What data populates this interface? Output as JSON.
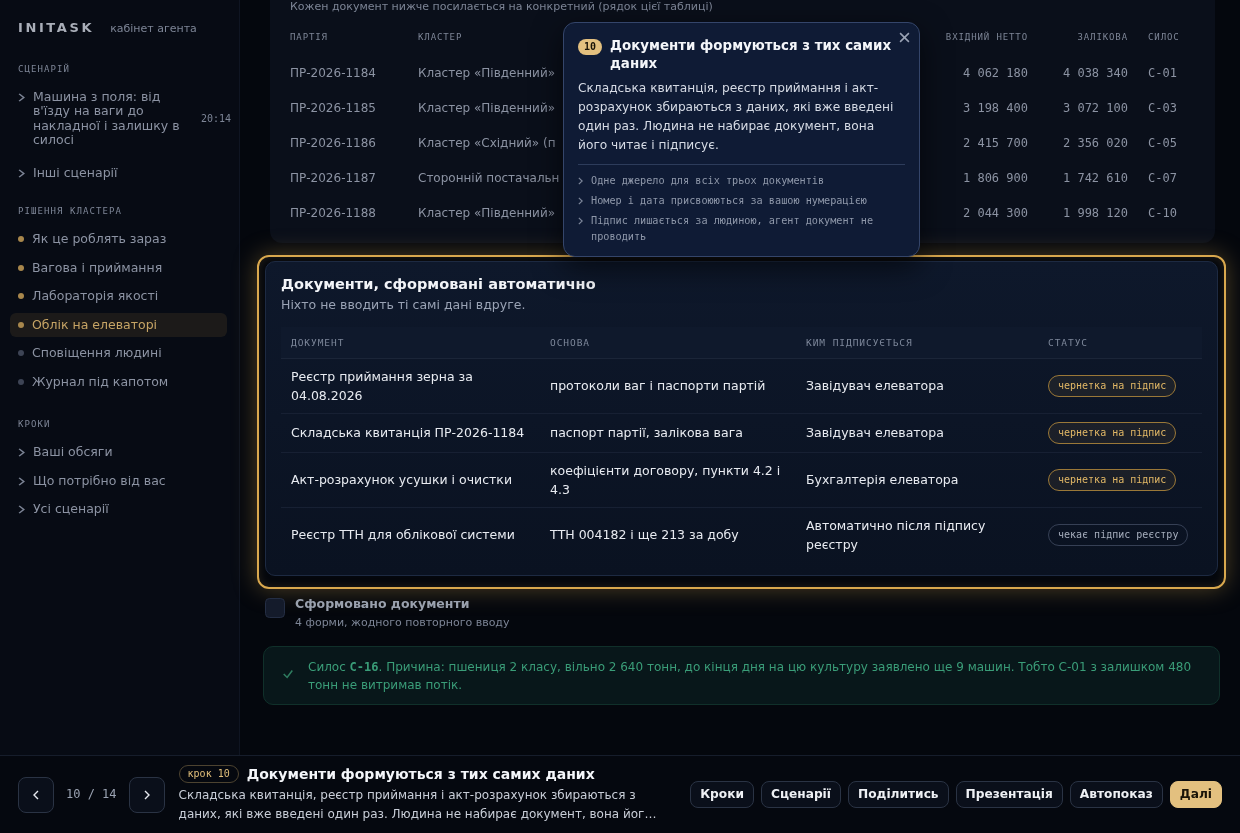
{
  "sidebar": {
    "brand": "INITASK",
    "subtitle": "кабінет агента",
    "sections": [
      {
        "title": "СЦЕНАРІЙ",
        "items": [
          {
            "kind": "link",
            "label": "Машина з поля: від в'їзду на ваги до накладної і залишку в силосі",
            "meta": "20:14"
          },
          {
            "kind": "link",
            "label": "Інші сценарії"
          }
        ]
      },
      {
        "title": "РІШЕННЯ КЛАСТЕРА",
        "items": [
          {
            "kind": "step",
            "label": "Як це роблять зараз",
            "done": true,
            "selected": false
          },
          {
            "kind": "step",
            "label": "Вагова і приймання",
            "done": true,
            "selected": false
          },
          {
            "kind": "step",
            "label": "Лабораторія якості",
            "done": true,
            "selected": false
          },
          {
            "kind": "step",
            "label": "Облік на елеваторі",
            "done": true,
            "selected": true
          },
          {
            "kind": "step",
            "label": "Сповіщення людині",
            "done": false,
            "selected": false
          },
          {
            "kind": "step",
            "label": "Журнал під капотом",
            "done": false,
            "selected": false
          }
        ]
      },
      {
        "title": "КРОКИ",
        "items": [
          {
            "kind": "link",
            "label": "Ваші обсяги"
          },
          {
            "kind": "link",
            "label": "Що потрібно від вас"
          },
          {
            "kind": "link",
            "label": "Усі сценарії"
          }
        ]
      }
    ]
  },
  "batches_table": {
    "caption": "Кожен документ нижче посилається на конкретний (рядок цієї таблиці)",
    "columns": [
      "ПАРТІЯ",
      "КЛАСТЕР",
      "ВХІДНИЙ НЕТТО",
      "ЗАЛІКОВА",
      "СИЛОС"
    ],
    "rows": [
      [
        "ПР-2026-1184",
        "Кластер «Південний»",
        "4 062 180",
        "4 038 340",
        "С-01"
      ],
      [
        "ПР-2026-1185",
        "Кластер «Південний»",
        "3 198 400",
        "3 072 100",
        "С-03"
      ],
      [
        "ПР-2026-1186",
        "Кластер «Східний» (п",
        "2 415 700",
        "2 356 020",
        "С-05"
      ],
      [
        "ПР-2026-1187",
        "Сторонній постачальн",
        "1 806 900",
        "1 742 610",
        "С-07"
      ],
      [
        "ПР-2026-1188",
        "Кластер «Південний»",
        "2 044 300",
        "1 998 120",
        "С-10"
      ]
    ]
  },
  "documents_card": {
    "title": "Документи, сформовані автоматично",
    "subtitle": "Ніхто не вводить ті самі дані вдруге.",
    "columns": [
      "ДОКУМЕНТ",
      "ОСНОВА",
      "КИМ ПІДПИСУЄТЬСЯ",
      "СТАТУС"
    ],
    "rows": [
      {
        "document": "Реєстр приймання зерна за 04.08.2026",
        "basis": "протоколи ваг і паспорти партій",
        "signer": "Завідувач елеватора",
        "status": {
          "kind": "draft",
          "label": "чернетка на підпис"
        }
      },
      {
        "document": "Складська квитанція ПР-2026-1184",
        "basis": "паспорт партії, залікова вага",
        "signer": "Завідувач елеватора",
        "status": {
          "kind": "draft",
          "label": "чернетка на підпис"
        }
      },
      {
        "document": "Акт-розрахунок усушки і очистки",
        "basis": "коефіцієнти договору, пункти 4.2 і 4.3",
        "signer": "Бухгалтерія елеватора",
        "status": {
          "kind": "draft",
          "label": "чернетка на підпис"
        }
      },
      {
        "document": "Реєстр ТТН для облікової системи",
        "basis": "ТТН 004182 і ще 213 за добу",
        "signer": "Автоматично після підпису реєстру",
        "status": {
          "kind": "waiting",
          "label": "чекає підпис реєстру"
        }
      }
    ]
  },
  "result_row": {
    "title": "Сформовано документи",
    "subtitle": "4 форми, жодного повторного вводу"
  },
  "notice": {
    "text": "Силос **С-16**. Причина: пшениця 2 класу, вільно 2 640 тонн, до кінця дня на цю культуру заявлено ще 9 машин. Тобто С-01 з залишком 480 тонн не витримав потік."
  },
  "tooltip": {
    "step": "10",
    "title": "Документи формуються з тих самих даних",
    "body": "Складська квитанція, реєстр приймання і акт-розрахунок збираються з даних, які вже введені один раз. Людина не набирає документ, вона його читає і підписує.",
    "points": [
      "Одне джерело для всіх трьох документів",
      "Номер і дата присвоюються за вашою нумерацією",
      "Підпис лишається за людиною, агент документ не проводить"
    ]
  },
  "footer": {
    "counter": "10 / 14",
    "step_label": "крок 10",
    "title": "Документи формуються з тих самих даних",
    "description": "Складська квитанція, реєстр приймання і акт-розрахунок збираються з даних, які вже введені один раз. Людина не набирає документ, вона йог…",
    "buttons": [
      {
        "label": "Кроки",
        "kind": "secondary"
      },
      {
        "label": "Сценарії",
        "kind": "secondary"
      },
      {
        "label": "Поділитись",
        "kind": "secondary"
      },
      {
        "label": "Презентація",
        "kind": "secondary"
      },
      {
        "label": "Автопоказ",
        "kind": "secondary"
      },
      {
        "label": "Далі",
        "kind": "primary"
      }
    ]
  }
}
